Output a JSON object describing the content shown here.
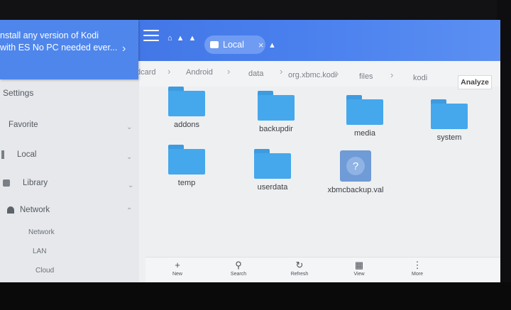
{
  "promo": {
    "line1": "nstall any version of Kodi",
    "line2": "with ES No PC needed ever...",
    "chevron_icon": "chevron-right-icon"
  },
  "header": {
    "tab_label": "Local",
    "menu_icon": "hamburger-menu-icon"
  },
  "pathbar": {
    "segments": [
      "dcard",
      "Android",
      "data",
      "org.xbmc.kodi",
      "files",
      "kodi"
    ],
    "analyze_label": "Analyze"
  },
  "sidebar": {
    "items": [
      {
        "label": "Settings"
      },
      {
        "label": "Favorite"
      },
      {
        "label": "Local"
      },
      {
        "label": "Library"
      },
      {
        "label": "Network"
      }
    ],
    "sub_items": [
      "Network",
      "LAN",
      "Cloud"
    ]
  },
  "files": [
    {
      "name": "addons",
      "kind": "folder"
    },
    {
      "name": "backupdir",
      "kind": "folder"
    },
    {
      "name": "media",
      "kind": "folder"
    },
    {
      "name": "system",
      "kind": "folder"
    },
    {
      "name": "temp",
      "kind": "folder"
    },
    {
      "name": "userdata",
      "kind": "folder"
    },
    {
      "name": "xbmcbackup.val",
      "kind": "unknown"
    }
  ],
  "toolbar": {
    "new": "New",
    "search": "Search",
    "refresh": "Refresh",
    "view": "View",
    "more": "More"
  },
  "colors": {
    "header_blue": "#4a80ee",
    "folder_blue": "#45a8ec",
    "screen_bg": "#eeeff1"
  }
}
